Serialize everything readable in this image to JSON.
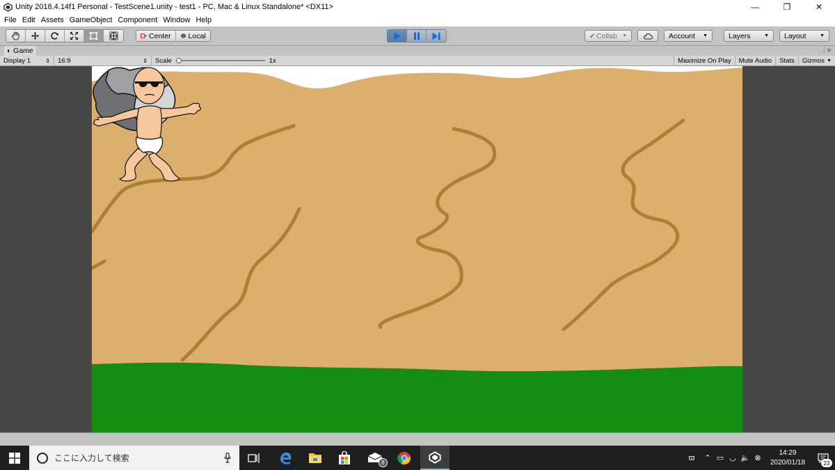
{
  "window": {
    "title": "Unity 2018.4.14f1 Personal - TestScene1.unity - test1 - PC, Mac & Linux Standalone* <DX11>",
    "app_icon": "unity-icon"
  },
  "menu": [
    "File",
    "Edit",
    "Assets",
    "GameObject",
    "Component",
    "Window",
    "Help"
  ],
  "toolbar": {
    "tools": [
      "hand-icon",
      "move-icon",
      "rotate-icon",
      "scale-icon",
      "rect-icon",
      "transform-icon"
    ],
    "pivot_label": "Center",
    "space_label": "Local",
    "play_state": "playing",
    "collab_label": "Collab",
    "account_label": "Account",
    "layers_label": "Layers",
    "layout_label": "Layout"
  },
  "game_tab": {
    "label": "Game",
    "display": "Display 1",
    "aspect": "16:9",
    "scale_label": "Scale",
    "scale_value": "1x",
    "maximize_on_play": "Maximize On Play",
    "mute_audio": "Mute Audio",
    "stats": "Stats",
    "gizmos": "Gizmos"
  },
  "scene": {
    "sky_color": "#ffffff",
    "cliff_color": "#dcaf6d",
    "crack_color": "#b07d34",
    "ground_color": "#138e13",
    "rock_colors": [
      "#6f7073",
      "#a1a1a3",
      "#d3d5d8"
    ],
    "skin_color": "#f7c79c"
  },
  "taskbar": {
    "search_placeholder": "ここに入力して検索",
    "apps": [
      "task-view-icon",
      "edge-icon",
      "file-explorer-icon",
      "store-icon",
      "mail-icon",
      "chrome-icon",
      "unity-icon"
    ],
    "mail_badge": "8",
    "time": "14:29",
    "date": "2020/01/18",
    "notification_count": "23"
  }
}
